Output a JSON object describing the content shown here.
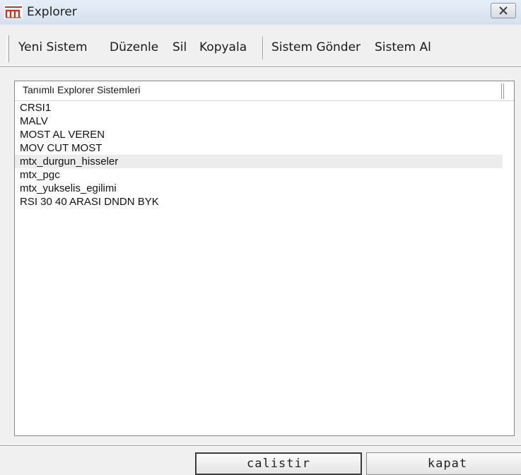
{
  "window": {
    "title": "Explorer",
    "close_icon": "close-icon"
  },
  "toolbar": {
    "items": [
      {
        "label": "Yeni Sistem"
      },
      {
        "label": "Düzenle"
      },
      {
        "label": "Sil"
      },
      {
        "label": "Kopyala"
      },
      {
        "label": "Sistem Gönder"
      },
      {
        "label": "Sistem Al"
      }
    ]
  },
  "list": {
    "header": "Tanımlı Explorer Sistemleri",
    "rows": [
      "CRSI1",
      "MALV",
      "MOST AL VEREN",
      "MOV CUT MOST",
      "mtx_durgun_hisseler",
      "mtx_pgc",
      "mtx_yukselis_egilimi",
      "RSI 30 40 ARASI DNDN BYK"
    ]
  },
  "buttons": {
    "run": "calistir",
    "close": "kapat"
  },
  "colors": {
    "logo": "#c0392b",
    "hover_row": "#ececec"
  }
}
